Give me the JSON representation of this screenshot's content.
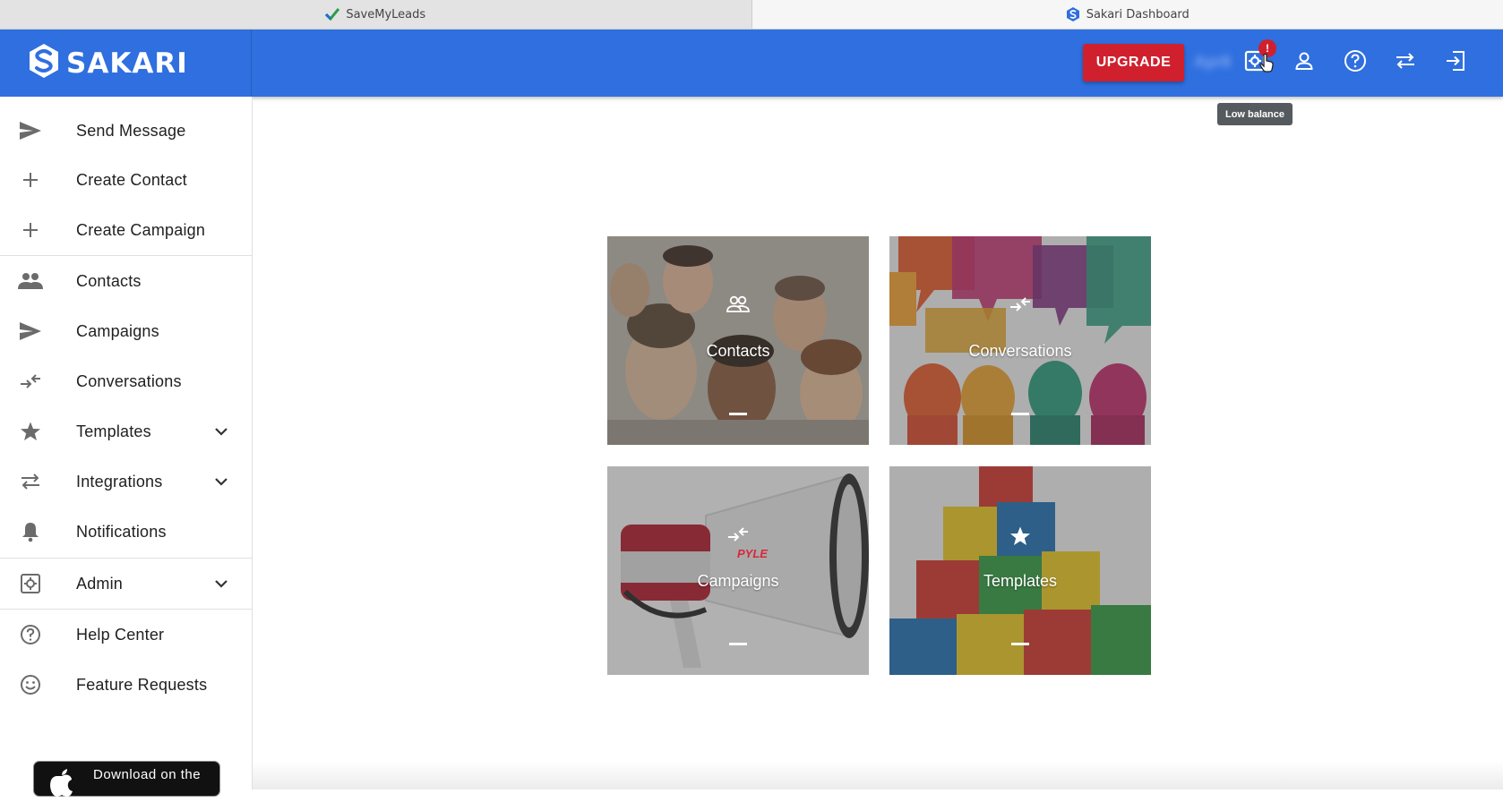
{
  "browser": {
    "tabs": [
      {
        "title": "SaveMyLeads",
        "active": false
      },
      {
        "title": "Sakari Dashboard",
        "active": true
      }
    ]
  },
  "header": {
    "logo_text": "SAKARI",
    "upgrade_label": "UPGRADE",
    "balance_text": "Apr8",
    "alert_badge": "!",
    "tooltip": "Low balance",
    "brand_color": "#2f6fdf",
    "upgrade_color": "#d0202e"
  },
  "sidebar": {
    "items": [
      {
        "label": "Send Message",
        "icon": "send-icon"
      },
      {
        "label": "Create Contact",
        "icon": "plus-icon"
      },
      {
        "label": "Create Campaign",
        "icon": "plus-icon"
      },
      {
        "label": "Contacts",
        "icon": "people-icon"
      },
      {
        "label": "Campaigns",
        "icon": "send-icon"
      },
      {
        "label": "Conversations",
        "icon": "swap-arrows-icon"
      },
      {
        "label": "Templates",
        "icon": "star-icon"
      },
      {
        "label": "Integrations",
        "icon": "swap-horizontal-icon"
      },
      {
        "label": "Notifications",
        "icon": "bell-icon"
      },
      {
        "label": "Admin",
        "icon": "admin-gear-icon"
      },
      {
        "label": "Help Center",
        "icon": "help-circle-icon"
      },
      {
        "label": "Feature Requests",
        "icon": "smiley-icon"
      }
    ],
    "appstore_label": "Download on the"
  },
  "tiles": [
    {
      "label": "Contacts",
      "icon": "people-outline-icon"
    },
    {
      "label": "Conversations",
      "icon": "swap-arrows-icon"
    },
    {
      "label": "Campaigns",
      "icon": "swap-arrows-icon",
      "brand_text": "PYLE"
    },
    {
      "label": "Templates",
      "icon": "star-icon"
    }
  ]
}
